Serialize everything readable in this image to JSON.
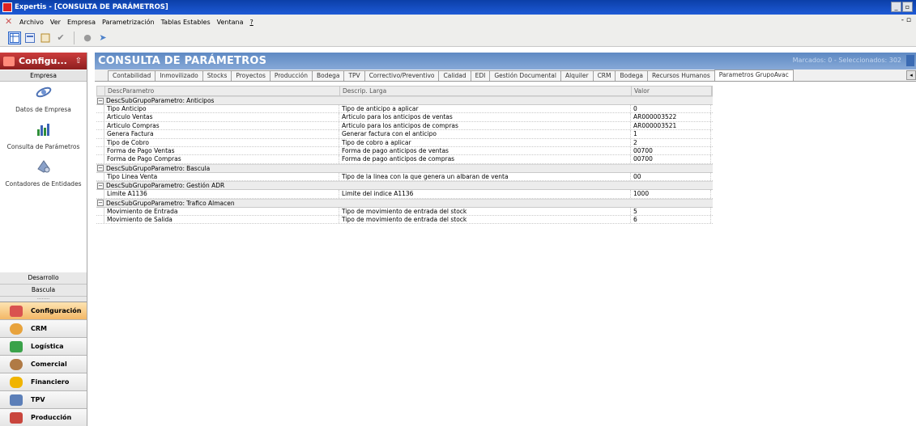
{
  "window": {
    "title": "Expertis - [CONSULTA DE PARÁMETROS]",
    "controls": [
      "_",
      "▫"
    ]
  },
  "menu": {
    "items": [
      "Archivo",
      "Ver",
      "Empresa",
      "Parametrización",
      "Tablas Estables",
      "Ventana",
      "?"
    ],
    "mdi_controls": "- ▫"
  },
  "toolbar": {
    "icons": [
      "grid-view-icon",
      "form-view-icon",
      "list-view-icon",
      "check-icon",
      "stop-icon",
      "play-icon"
    ]
  },
  "left_panel": {
    "header": "Configu...",
    "pin_glyph": "⇧",
    "group_top": "Empresa",
    "items": [
      {
        "label": "Datos de Empresa",
        "icon": "satellite-icon"
      },
      {
        "label": "Consulta de Parámetros",
        "icon": "bar-chart-icon"
      },
      {
        "label": "Contadores de Entidades",
        "icon": "counter-icon"
      }
    ],
    "groups_bottom": [
      "Desarrollo",
      "Bascula"
    ],
    "dots": "........",
    "modules": [
      {
        "label": "Configuración",
        "color": "#d9534f"
      },
      {
        "label": "CRM",
        "color": "#e8a33d"
      },
      {
        "label": "Logística",
        "color": "#3aa24a"
      },
      {
        "label": "Comercial",
        "color": "#b07a45"
      },
      {
        "label": "Financiero",
        "color": "#f0b400"
      },
      {
        "label": "TPV",
        "color": "#5c7fb8"
      },
      {
        "label": "Producción",
        "color": "#c9463d"
      }
    ]
  },
  "main": {
    "title": "CONSULTA DE PARÁMETROS",
    "stats": "Marcados: 0 - Seleccionados: 302",
    "tabs": [
      "Contabilidad",
      "Inmovilizado",
      "Stocks",
      "Proyectos",
      "Producción",
      "Bodega",
      "TPV",
      "Correctivo/Preventivo",
      "Calidad",
      "EDI",
      "Gestión Documental",
      "Alquiler",
      "CRM",
      "Bodega",
      "Recursos Humanos",
      "Parametros GrupoAvac"
    ],
    "active_tab_index": 15,
    "tab_scroll": "◂"
  },
  "grid": {
    "columns": [
      "DescParametro",
      "Descrip. Larga",
      "Valor"
    ],
    "group_prefix": "DescSubGrupoParametro: ",
    "groups": [
      {
        "name": "Anticipos",
        "rows": [
          [
            "Tipo Anticipo",
            "Tipo de anticipo a aplicar",
            "0"
          ],
          [
            "Articulo Ventas",
            "Articulo para los anticipos de ventas",
            "AR000003522"
          ],
          [
            "Articulo Compras",
            "Articulo para los anticipos de compras",
            "AR000003521"
          ],
          [
            "Genera Factura",
            "Generar factura con el anticipo",
            "1"
          ],
          [
            "Tipo de Cobro",
            "Tipo de cobro a aplicar",
            "2"
          ],
          [
            "Forma de Pago Ventas",
            "Forma de pago anticipos de ventas",
            "00700"
          ],
          [
            "Forma de Pago Compras",
            "Forma de pago anticipos de compras",
            "00700"
          ]
        ]
      },
      {
        "name": "Bascula",
        "rows": [
          [
            "Tipo Linea Venta",
            "Tipo de la linea con la que genera un albaran de venta",
            "00"
          ]
        ]
      },
      {
        "name": "Gestión ADR",
        "rows": [
          [
            "Limite A1136",
            "Limite del indice A1136",
            "1000"
          ]
        ]
      },
      {
        "name": "Trafico Almacen",
        "rows": [
          [
            "Movimiento de Entrada",
            "Tipo de movimiento de entrada del stock",
            "5"
          ],
          [
            "Movimiento de Salida",
            "Tipo de movimiento de entrada del stock",
            "6"
          ]
        ]
      }
    ]
  }
}
